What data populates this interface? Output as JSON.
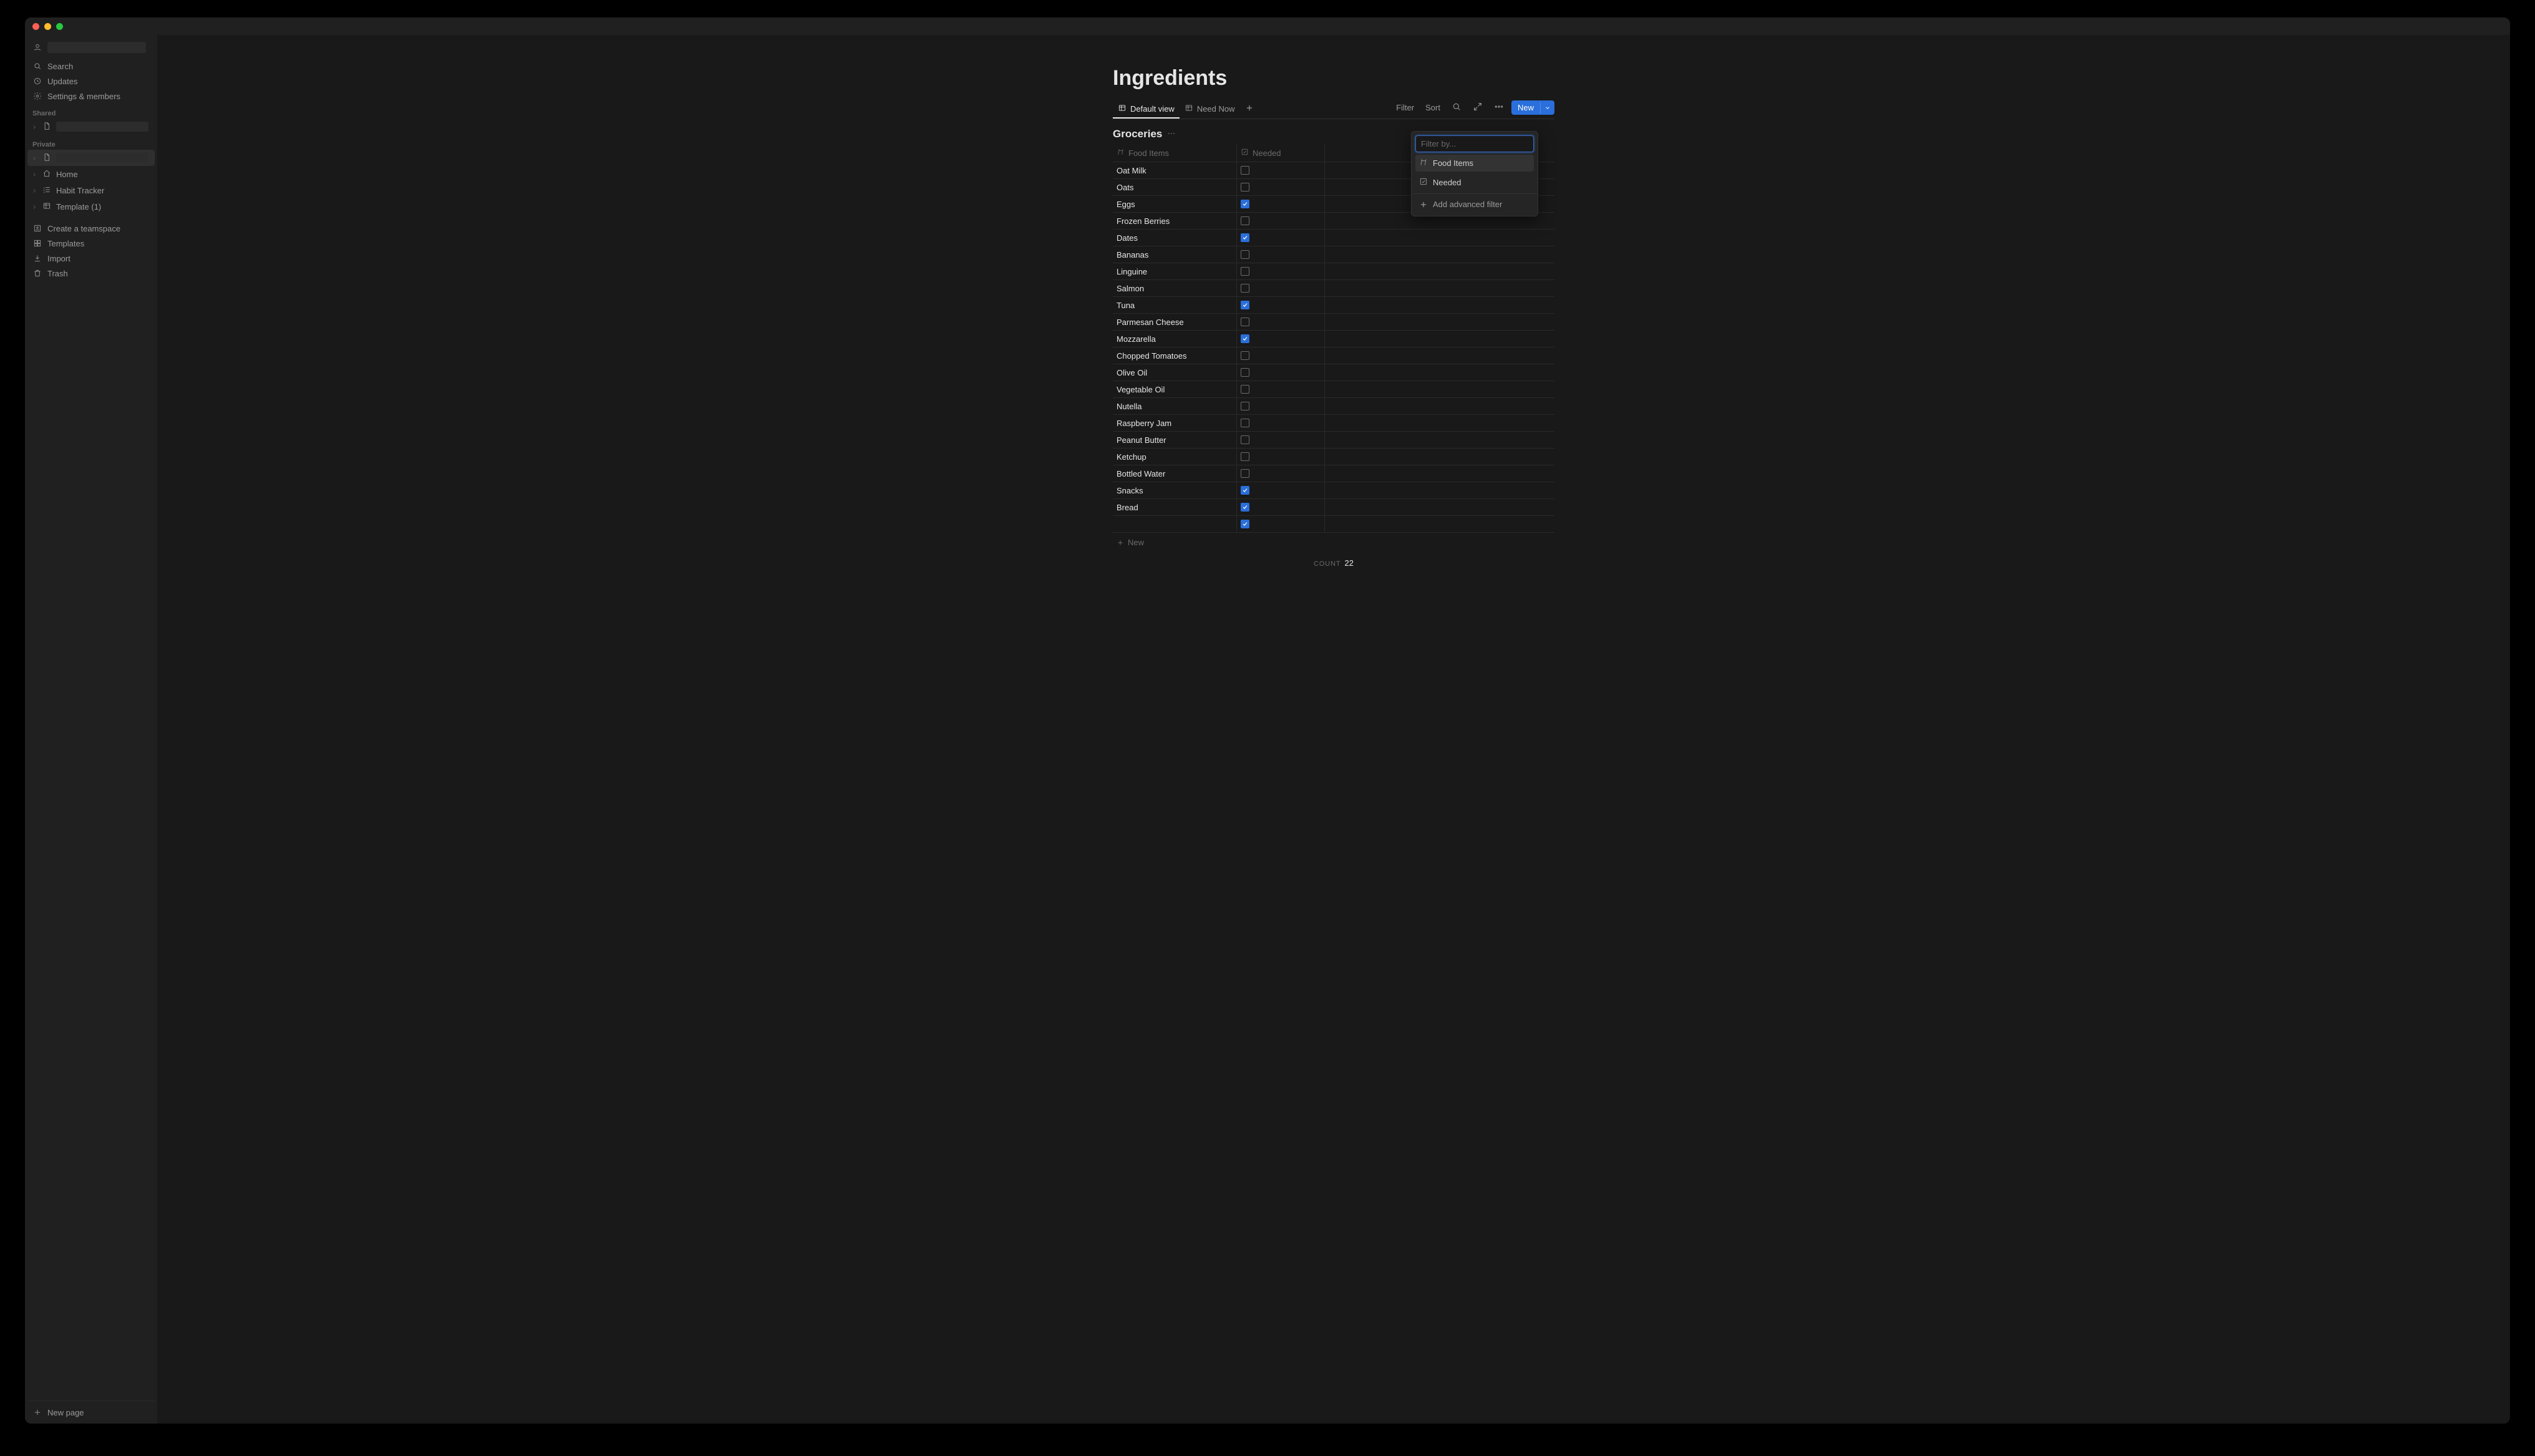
{
  "sidebar": {
    "search": "Search",
    "updates": "Updates",
    "settings": "Settings & members",
    "shared_label": "Shared",
    "private_label": "Private",
    "private_items": [
      {
        "label": "Home",
        "icon": "home"
      },
      {
        "label": "Habit Tracker",
        "icon": "list"
      },
      {
        "label": "Template (1)",
        "icon": "board"
      }
    ],
    "create_teamspace": "Create a teamspace",
    "templates": "Templates",
    "import": "Import",
    "trash": "Trash",
    "new_page": "New page"
  },
  "page": {
    "title": "Ingredients",
    "tabs": [
      {
        "label": "Default view",
        "active": true
      },
      {
        "label": "Need Now",
        "active": false
      }
    ],
    "toolbar": {
      "filter": "Filter",
      "sort": "Sort",
      "new": "New"
    },
    "group_title": "Groceries",
    "columns": {
      "name": "Food Items",
      "needed": "Needed"
    },
    "rows": [
      {
        "name": "Oat Milk",
        "needed": false
      },
      {
        "name": "Oats",
        "needed": false
      },
      {
        "name": "Eggs",
        "needed": true
      },
      {
        "name": "Frozen Berries",
        "needed": false
      },
      {
        "name": "Dates",
        "needed": true
      },
      {
        "name": "Bananas",
        "needed": false
      },
      {
        "name": "Linguine",
        "needed": false
      },
      {
        "name": "Salmon",
        "needed": false
      },
      {
        "name": "Tuna",
        "needed": true
      },
      {
        "name": "Parmesan Cheese",
        "needed": false
      },
      {
        "name": "Mozzarella",
        "needed": true
      },
      {
        "name": "Chopped Tomatoes",
        "needed": false
      },
      {
        "name": "Olive Oil",
        "needed": false
      },
      {
        "name": "Vegetable Oil",
        "needed": false
      },
      {
        "name": "Nutella",
        "needed": false
      },
      {
        "name": "Raspberry Jam",
        "needed": false
      },
      {
        "name": "Peanut Butter",
        "needed": false
      },
      {
        "name": "Ketchup",
        "needed": false
      },
      {
        "name": "Bottled Water",
        "needed": false
      },
      {
        "name": "Snacks",
        "needed": true
      },
      {
        "name": "Bread",
        "needed": true
      },
      {
        "name": "",
        "needed": true
      }
    ],
    "new_row": "New",
    "count_label": "Count",
    "count_value": "22"
  },
  "filter_popup": {
    "placeholder": "Filter by...",
    "options": [
      {
        "label": "Food Items",
        "icon": "text"
      },
      {
        "label": "Needed",
        "icon": "checkbox"
      }
    ],
    "advanced": "Add advanced filter"
  }
}
